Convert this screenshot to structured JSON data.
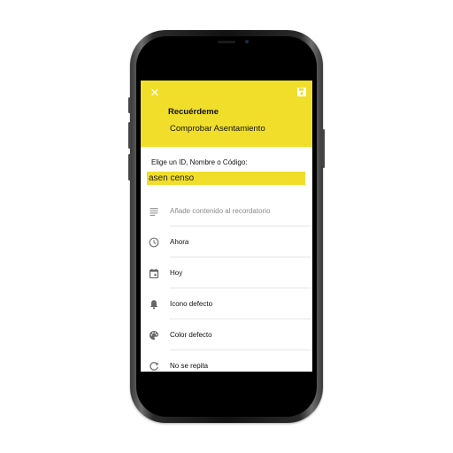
{
  "header": {
    "close_icon": "close-icon",
    "save_icon": "save-icon",
    "title": "Recuérdeme",
    "subtitle": "Comprobar Asentamiento",
    "color": "#f0de2a"
  },
  "form": {
    "label": "Elige un ID, Nombre o Código:",
    "value": "asen censo"
  },
  "options": [
    {
      "icon": "notes-icon",
      "label": "Añade contenido al recordatorio",
      "placeholder": true
    },
    {
      "icon": "clock-icon",
      "label": "Ahora"
    },
    {
      "icon": "calendar-icon",
      "label": "Hoy"
    },
    {
      "icon": "bell-icon",
      "label": "Icono defecto"
    },
    {
      "icon": "palette-icon",
      "label": "Color defecto"
    },
    {
      "icon": "repeat-icon",
      "label": "No se repita"
    }
  ]
}
